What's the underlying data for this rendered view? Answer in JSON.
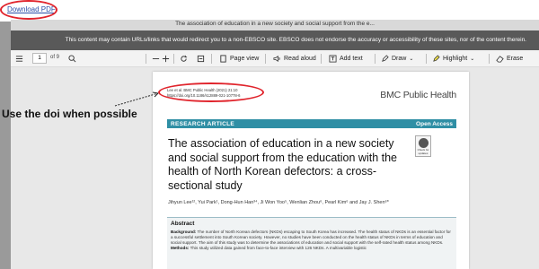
{
  "topbar": {
    "download_label": "Download PDF"
  },
  "doc": {
    "title": "The association of education in a new society and social support from the e...",
    "warning": "This content may contain URLs/links that would redirect you to a non-EBSCO site. EBSCO does not endorse the accuracy or accessibility of these sites, nor of the content therein."
  },
  "toolbar": {
    "page_current": "1",
    "page_of": "of 9",
    "page_view": "Page view",
    "read_aloud": "Read aloud",
    "add_text": "Add text",
    "draw": "Draw",
    "highlight": "Highlight",
    "erase": "Erase"
  },
  "paper": {
    "citation_line1": "Lee et al. BMC Public Health      (2021) 21:10",
    "citation_line2": "https://doi.org/10.1186/s12889-021-10778-6",
    "journal": "BMC Public Health",
    "section_label": "RESEARCH ARTICLE",
    "access_label": "Open Access",
    "badge_text": "Check for updates",
    "title": "The association of education in a new society and social support from the education with the health of North Korean defectors: a cross-sectional study",
    "authors": "Jihyun Lee¹², Yui Park¹, Dong-Hun Han³⁴, Ji Won Yoo⁵, Wenlian Zhou⁶, Pearl Kim⁶ and Jay J. Shen⁶*",
    "abstract_heading": "Abstract",
    "background_label": "Background:",
    "background_text": "The number of North Korean defectors (NKDs) escaping to South Korea has increased. The health status of NKDs is an essential factor for a successful settlement into South Korean society. However, no studies have been conducted on the health status of NKDs in terms of education and social support. The aim of this study was to determine the associations of education and social support with the self-rated health status among NKDs.",
    "methods_label": "Methods:",
    "methods_text": "This study utilized data gained from face-to-face interview with 126 NKDs. A multivariable logistic"
  },
  "annotation": {
    "text": "Use the doi when possible"
  },
  "colors": {
    "annotation_red": "#e0242c",
    "article_bar": "#2f8fa5",
    "banner": "#595959"
  }
}
